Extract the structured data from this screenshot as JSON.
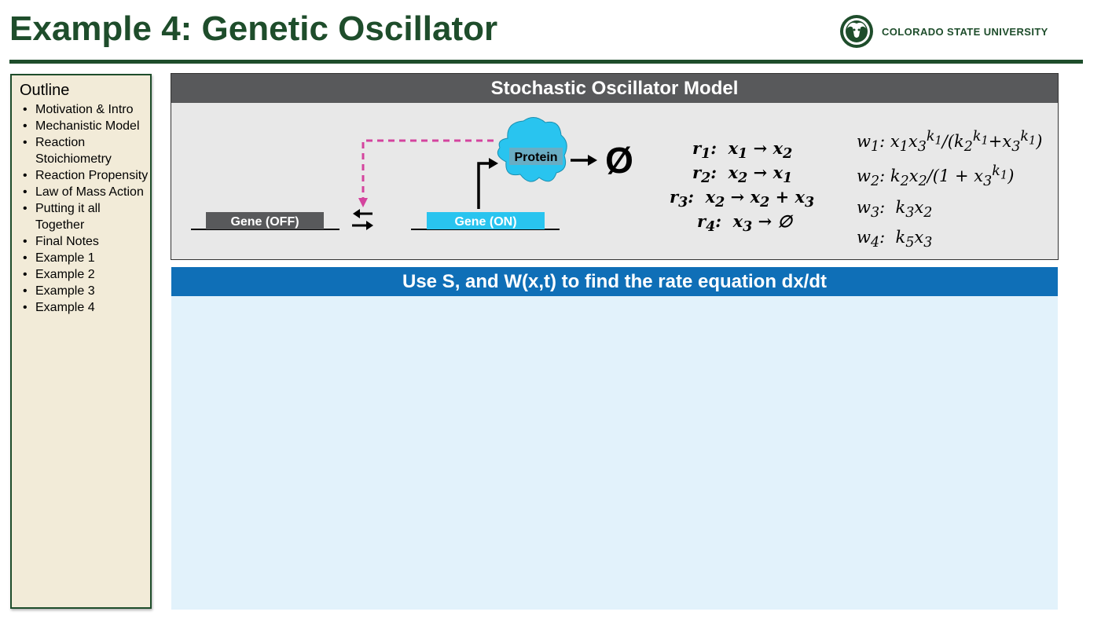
{
  "slide": {
    "title": "Example 4:  Genetic Oscillator",
    "university": "COLORADO STATE UNIVERSITY"
  },
  "outline": {
    "heading": "Outline",
    "items": [
      "Motivation & Intro",
      "Mechanistic Model",
      "Reaction Stoichiometry",
      "Reaction Propensity",
      "Law of Mass Action",
      "Putting it all Together",
      "Final Notes",
      "Example 1",
      "Example 2",
      "Example 3",
      "Example 4"
    ]
  },
  "model": {
    "header": "Stochastic Oscillator Model",
    "gene_off_label": "Gene (OFF)",
    "gene_on_label": "Gene (ON)",
    "protein_label": "Protein",
    "degradation_symbol": "Ø",
    "reactions": [
      {
        "name": "r",
        "sub": "1",
        "lhs": "x",
        "lhs_sub": "1",
        "arrow": "→",
        "rhs": "x",
        "rhs_sub": "2"
      },
      {
        "name": "r",
        "sub": "2",
        "lhs": "x",
        "lhs_sub": "2",
        "arrow": "→",
        "rhs": "x",
        "rhs_sub": "1"
      },
      {
        "name": "r",
        "sub": "3",
        "lhs": "x",
        "lhs_sub": "2",
        "arrow": "→",
        "rhs": "x₂ + x₃"
      },
      {
        "name": "r",
        "sub": "4",
        "lhs": "x",
        "lhs_sub": "3",
        "arrow": "→",
        "rhs": "∅"
      }
    ],
    "propensities": [
      "w₁: x₁x₃^k₁/(k₂^k₁+x₃^k₁)",
      "w₂: k₂x₂/(1 + x₃^k₁)",
      "w₃:  k₃x₂",
      "w₄:  k₅x₃"
    ]
  },
  "task": {
    "header": "Use S, and W(x,t) to find the rate equation dx/dt"
  },
  "colors": {
    "csu_green": "#1e4d2b",
    "header_gray": "#58595b",
    "task_blue": "#0f6fb7",
    "gene_on": "#29c4ef",
    "gene_off": "#58595b",
    "protein": "#29c4ef",
    "repression": "#d4449e"
  }
}
